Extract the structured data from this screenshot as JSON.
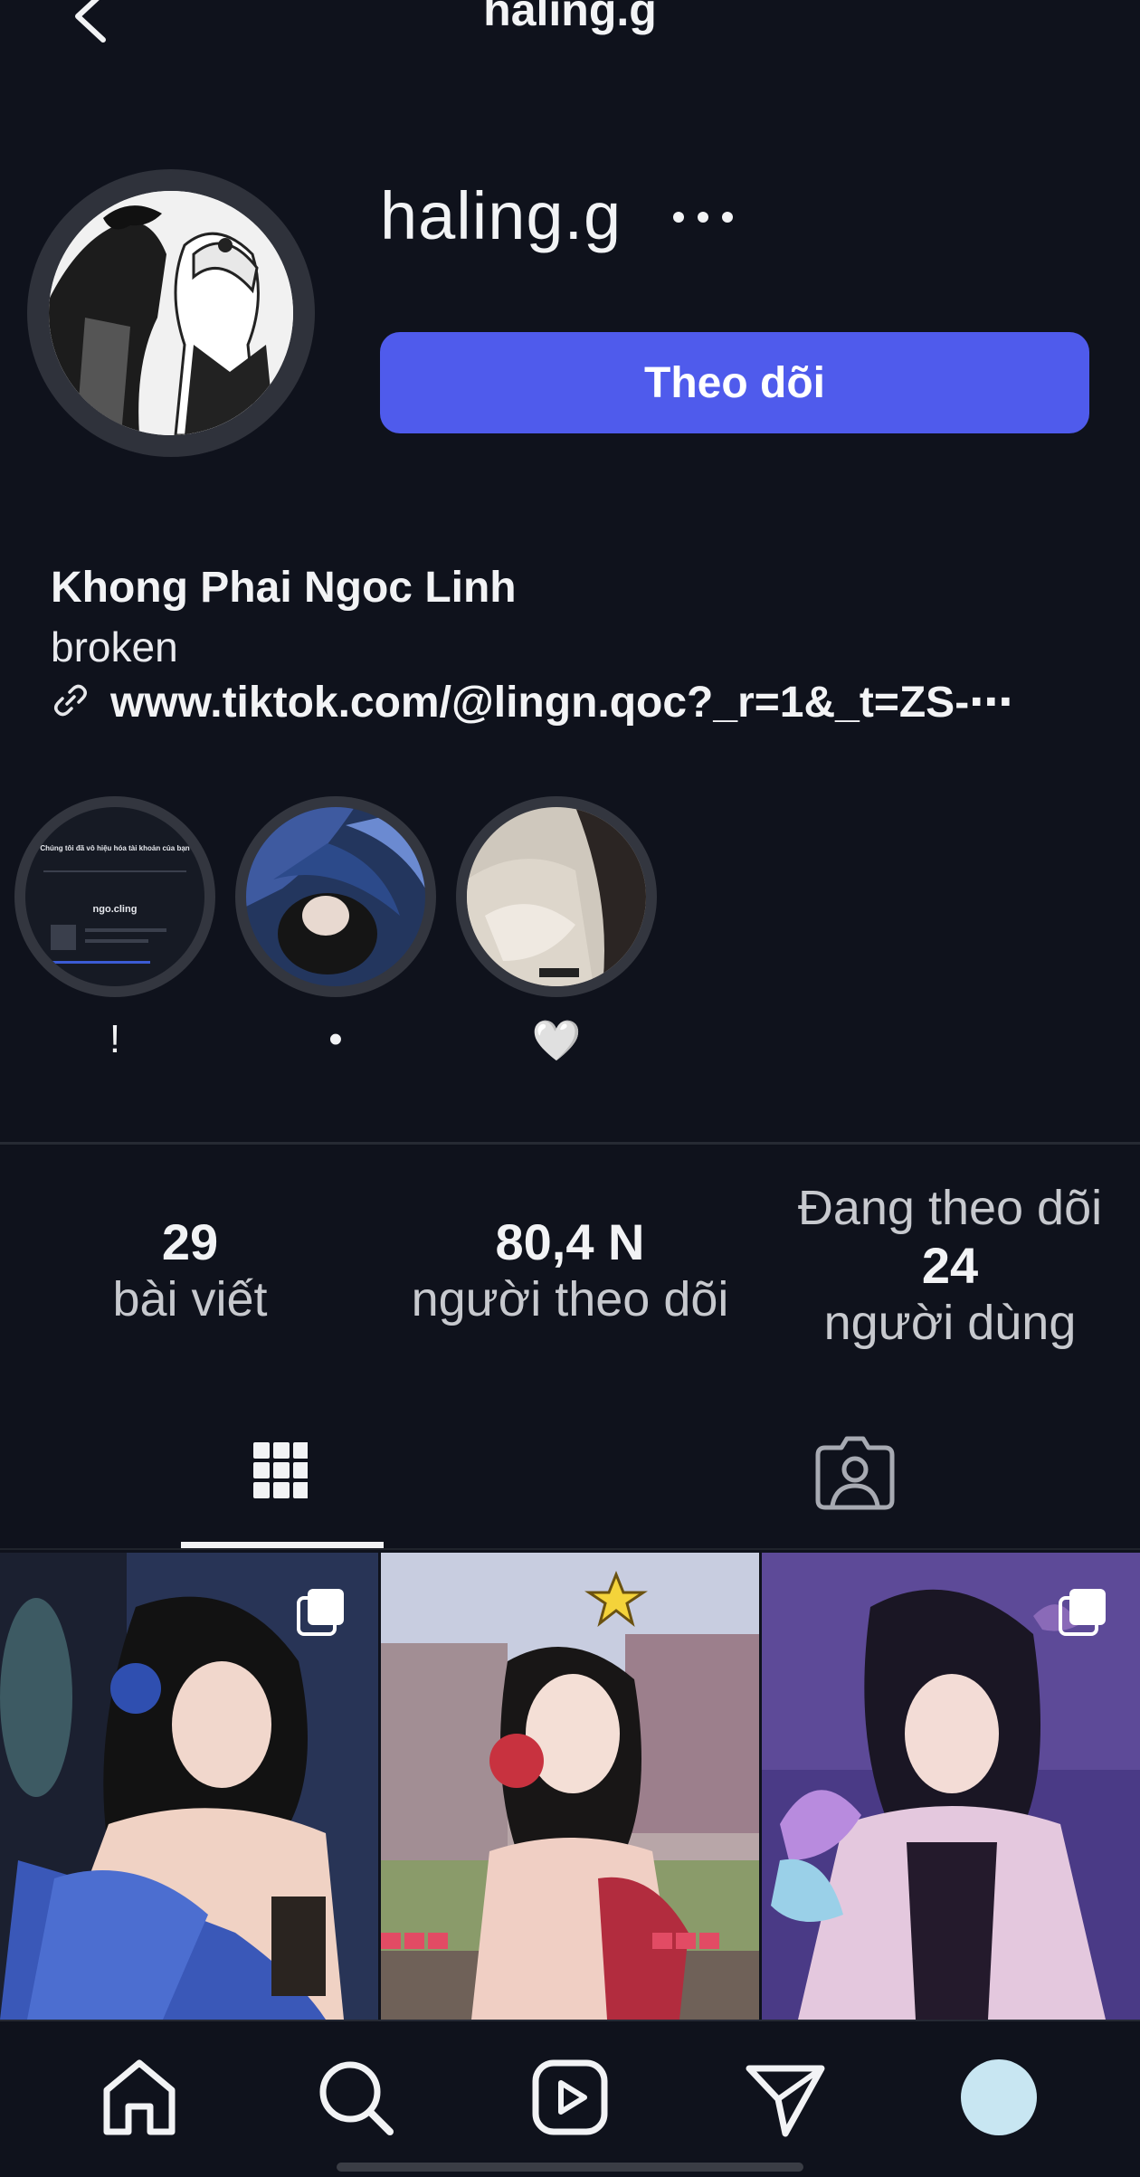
{
  "header": {
    "title": "haling.g",
    "back_icon": "chevron-left-icon"
  },
  "profile": {
    "username": "haling.g",
    "more_icon": "more-horizontal-icon",
    "follow_label": "Theo dõi",
    "full_name": "Khong Phai Ngoc Linh",
    "bio": "broken",
    "link": "www.tiktok.com/@lingn.qoc?_r=1&_t=ZS-⋯",
    "accent_color": "#4f5bec"
  },
  "highlights": [
    {
      "label": "!",
      "preview_title": "Chúng tôi đã vô hiệu hóa tài khoản của bạn",
      "preview_handle": "ngo.cling"
    },
    {
      "label": "•"
    },
    {
      "label": "🤍"
    }
  ],
  "stats": {
    "posts_num": "29",
    "posts_label": "bài viết",
    "followers_num": "80,4 N",
    "followers_label": "người theo dõi",
    "following_top": "Đang theo dõi",
    "following_num": "24",
    "following_label": "người dùng"
  },
  "tabs": [
    {
      "name": "posts-grid-tab",
      "icon": "grid-icon",
      "active": true
    },
    {
      "name": "tagged-tab",
      "icon": "tagged-person-icon",
      "active": false
    }
  ],
  "posts": [
    {
      "name": "post-1",
      "multi": true
    },
    {
      "name": "post-2",
      "multi": false
    },
    {
      "name": "post-3",
      "multi": true
    }
  ],
  "nav": [
    "home-icon",
    "search-icon",
    "reels-icon",
    "send-icon",
    "profile-avatar"
  ]
}
